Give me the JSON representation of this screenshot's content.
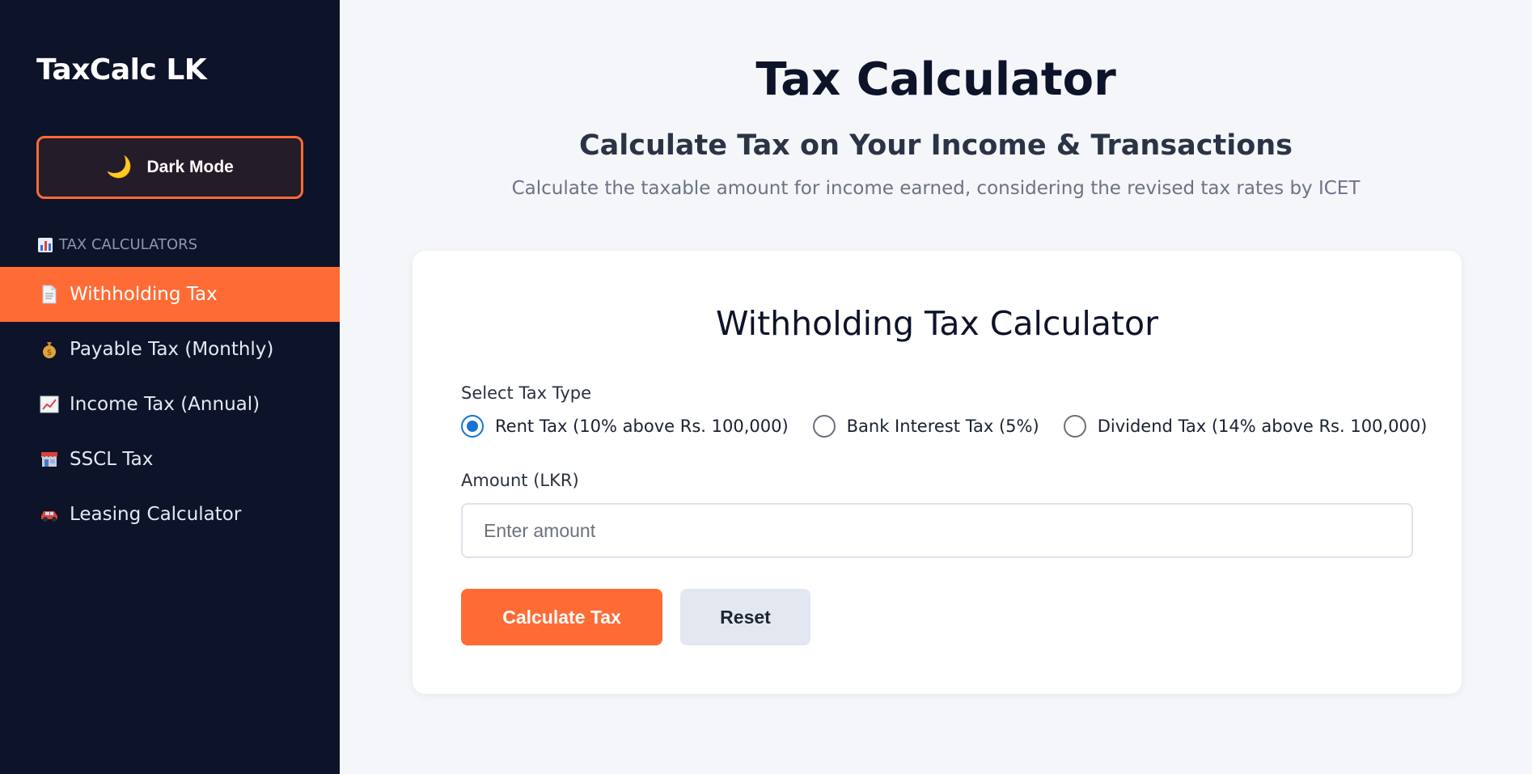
{
  "sidebar": {
    "brand": "TaxCalc LK",
    "dark_mode_label": "Dark Mode",
    "section_heading": "TAX CALCULATORS",
    "items": [
      {
        "label": "Withholding Tax",
        "icon": "document-icon",
        "active": true
      },
      {
        "label": "Payable Tax (Monthly)",
        "icon": "money-bag-icon",
        "active": false
      },
      {
        "label": "Income Tax (Annual)",
        "icon": "chart-up-icon",
        "active": false
      },
      {
        "label": "SSCL Tax",
        "icon": "store-icon",
        "active": false
      },
      {
        "label": "Leasing Calculator",
        "icon": "car-icon",
        "active": false
      }
    ]
  },
  "header": {
    "title": "Tax Calculator",
    "subtitle": "Calculate Tax on Your Income & Transactions",
    "description": "Calculate the taxable amount for income earned, considering the revised tax rates by ICET"
  },
  "card": {
    "title": "Withholding Tax Calculator",
    "tax_type_label": "Select Tax Type",
    "tax_types": [
      {
        "label": "Rent Tax (10% above Rs. 100,000)",
        "checked": true
      },
      {
        "label": "Bank Interest Tax (5%)",
        "checked": false
      },
      {
        "label": "Dividend Tax (14% above Rs. 100,000)",
        "checked": false
      }
    ],
    "amount_label": "Amount (LKR)",
    "amount_placeholder": "Enter amount",
    "amount_value": "",
    "calculate_label": "Calculate Tax",
    "reset_label": "Reset"
  },
  "colors": {
    "sidebar_bg": "#0d1329",
    "accent": "#ff6b35",
    "radio_checked": "#1673d6",
    "page_bg": "#f5f6f9"
  }
}
